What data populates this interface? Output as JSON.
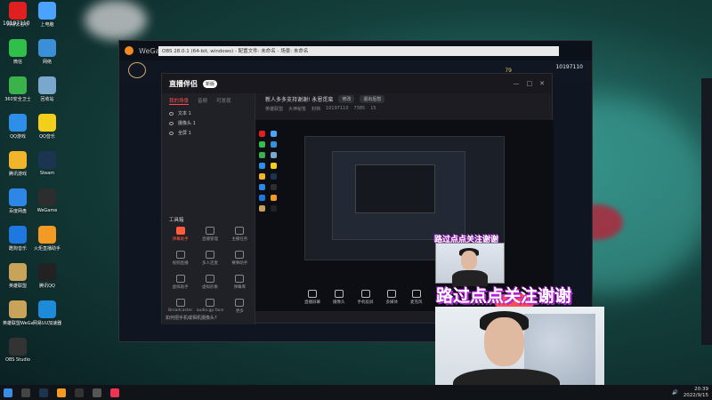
{
  "desktop": {
    "top_time": "10197110",
    "icons": [
      {
        "label": "网易云音乐",
        "color": "#e02020"
      },
      {
        "label": "上电脑",
        "color": "#4aa3ff"
      },
      {
        "label": "微信",
        "color": "#2fbf4a"
      },
      {
        "label": "网络",
        "color": "#3b8ed8"
      },
      {
        "label": "360安全卫士",
        "color": "#3bb34a"
      },
      {
        "label": "回收站",
        "color": "#7aa7cc"
      },
      {
        "label": "QQ游戏",
        "color": "#2e8ee8"
      },
      {
        "label": "QQ音乐",
        "color": "#f2cf1a"
      },
      {
        "label": "腾讯游戏",
        "color": "#f0b52a"
      },
      {
        "label": "Steam",
        "color": "#1b3550"
      },
      {
        "label": "百度网盘",
        "color": "#2e87e6"
      },
      {
        "label": "WeGame",
        "color": "#2d2d2d"
      },
      {
        "label": "酷狗音乐",
        "color": "#1f77e0"
      },
      {
        "label": "火炬直播助手",
        "color": "#f29b24"
      },
      {
        "label": "英雄联盟",
        "color": "#c8a35a"
      },
      {
        "label": "腾讯QQ",
        "color": "#222"
      },
      {
        "label": "英雄联盟WeGame版",
        "color": "#c8a35a"
      },
      {
        "label": "网易UU加速器",
        "color": "#1e8bd8"
      },
      {
        "label": "OBS Studio",
        "color": "#333"
      }
    ]
  },
  "wegame": {
    "title": "WeGame",
    "obs_title": "OBS 28.0.1 (64-bit, windows) - 配置文件: 未命名 - 场景: 未命名",
    "user_id": "10197110",
    "coins": "79"
  },
  "live_app": {
    "title": "直播伴侣",
    "badge": "新版",
    "tabs": [
      "我的场景",
      "音频",
      "可发现"
    ],
    "scenes": [
      "文本 1",
      "摄像头 1",
      "全屏 1"
    ],
    "tools_title": "工具箱",
    "tools": [
      {
        "label": "弹幕助手",
        "hot": true
      },
      {
        "label": "直播管理",
        "hot": false
      },
      {
        "label": "主播任务",
        "hot": false
      },
      {
        "label": "视频直播",
        "hot": false
      },
      {
        "label": "多人连麦",
        "hot": false
      },
      {
        "label": "赛事助手",
        "hot": false
      },
      {
        "label": "虚拟助手",
        "hot": false
      },
      {
        "label": "虚拟形象",
        "hot": false
      },
      {
        "label": "弹幕库",
        "hot": false
      },
      {
        "label": "Broadcaster",
        "hot": false
      },
      {
        "label": "audio.gp.face",
        "hot": false
      },
      {
        "label": "更多",
        "hot": false
      }
    ],
    "help_text": "如何把手机或相机摄像头?",
    "info_line": "新人多多支持谢谢! 永恩觅蛮",
    "info_pill1": "修改",
    "info_pill2": "退出后暂",
    "info_row2": [
      "英雄联盟",
      "大神秘笈",
      "封档",
      "10197110",
      "7385",
      "15"
    ],
    "bottom_tools": [
      "直播屏幕",
      "摄像头",
      "手机投屏",
      "多媒体",
      "麦克风"
    ]
  },
  "overlay": {
    "caption_small": "路过点点关注谢谢",
    "caption_big": "路过点点关注谢谢"
  },
  "taskbar": {
    "time": "20:39",
    "date": "2022/9/15"
  }
}
